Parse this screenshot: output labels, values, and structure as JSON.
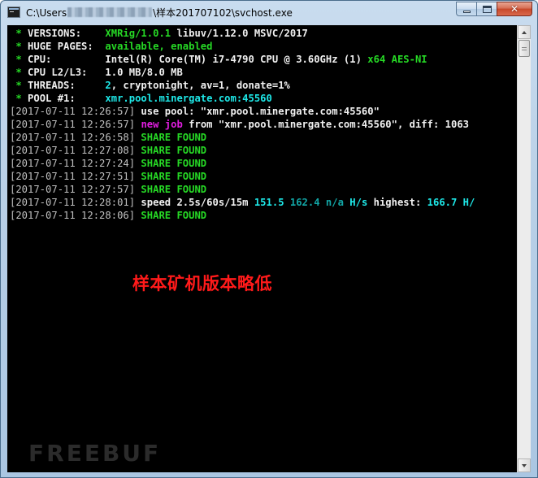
{
  "window": {
    "title_prefix": "C:\\Users",
    "title_suffix": "\\样本201707102\\svchost.exe",
    "close_glyph": "✕"
  },
  "console": {
    "info": [
      {
        "bullet": " * ",
        "label": "VERSIONS:    ",
        "parts": [
          {
            "text": "XMRig/1.0.1",
            "color": "green"
          },
          {
            "text": " libuv/1.12.0 MSVC/2017",
            "color": "white"
          }
        ]
      },
      {
        "bullet": " * ",
        "label": "HUGE PAGES:  ",
        "parts": [
          {
            "text": "available, enabled",
            "color": "green"
          }
        ]
      },
      {
        "bullet": " * ",
        "label": "CPU:         ",
        "parts": [
          {
            "text": "Intel(R) Core(TM) i7-4790 CPU @ 3.60GHz (1) ",
            "color": "white"
          },
          {
            "text": "x64 AES-NI",
            "color": "green"
          }
        ]
      },
      {
        "bullet": " * ",
        "label": "CPU L2/L3:   ",
        "parts": [
          {
            "text": "1.0 MB/8.0 MB",
            "color": "white"
          }
        ]
      },
      {
        "bullet": " * ",
        "label": "THREADS:     ",
        "parts": [
          {
            "text": "2",
            "color": "cyan"
          },
          {
            "text": ", cryptonight, av=1, donate=1%",
            "color": "white"
          }
        ]
      },
      {
        "bullet": " * ",
        "label": "POOL #1:     ",
        "parts": [
          {
            "text": "xmr.pool.minergate.com:45560",
            "color": "cyan"
          }
        ]
      }
    ],
    "log": [
      {
        "ts": "[2017-07-11 12:26:57]",
        "parts": [
          {
            "text": " use pool: \"xmr.pool.minergate.com:45560\"",
            "color": "white"
          }
        ]
      },
      {
        "ts": "[2017-07-11 12:26:57]",
        "parts": [
          {
            "text": " ",
            "color": "white"
          },
          {
            "text": "new job",
            "color": "magenta"
          },
          {
            "text": " from \"xmr.pool.minergate.com:45560\", diff: 1063",
            "color": "white"
          }
        ]
      },
      {
        "ts": "[2017-07-11 12:26:58]",
        "parts": [
          {
            "text": " SHARE FOUND",
            "color": "green"
          }
        ]
      },
      {
        "ts": "[2017-07-11 12:27:08]",
        "parts": [
          {
            "text": " SHARE FOUND",
            "color": "green"
          }
        ]
      },
      {
        "ts": "[2017-07-11 12:27:24]",
        "parts": [
          {
            "text": " SHARE FOUND",
            "color": "green"
          }
        ]
      },
      {
        "ts": "[2017-07-11 12:27:51]",
        "parts": [
          {
            "text": " SHARE FOUND",
            "color": "green"
          }
        ]
      },
      {
        "ts": "[2017-07-11 12:27:57]",
        "parts": [
          {
            "text": " SHARE FOUND",
            "color": "green"
          }
        ]
      },
      {
        "ts": "[2017-07-11 12:28:01]",
        "parts": [
          {
            "text": " speed 2.5s/60s/15m ",
            "color": "white"
          },
          {
            "text": "151.5",
            "color": "cyan"
          },
          {
            "text": " ",
            "color": "white"
          },
          {
            "text": "162.4 n/a",
            "color": "teal"
          },
          {
            "text": " ",
            "color": "white"
          },
          {
            "text": "H/s",
            "color": "cyan"
          },
          {
            "text": " highest: ",
            "color": "white"
          },
          {
            "text": "166.7 H/",
            "color": "cyan"
          }
        ]
      },
      {
        "ts": "[2017-07-11 12:28:06]",
        "parts": [
          {
            "text": " SHARE FOUND",
            "color": "green"
          }
        ]
      }
    ]
  },
  "caption": "样本矿机版本略低",
  "watermark": "FREEBUF",
  "colors": {
    "green": "#26d925",
    "white": "#f0f0f0",
    "cyan": "#1ee8e8",
    "teal": "#12a6a6",
    "magenta": "#e11de1",
    "gray": "#c0c0c0",
    "caption_red": "#ff1a1a"
  }
}
